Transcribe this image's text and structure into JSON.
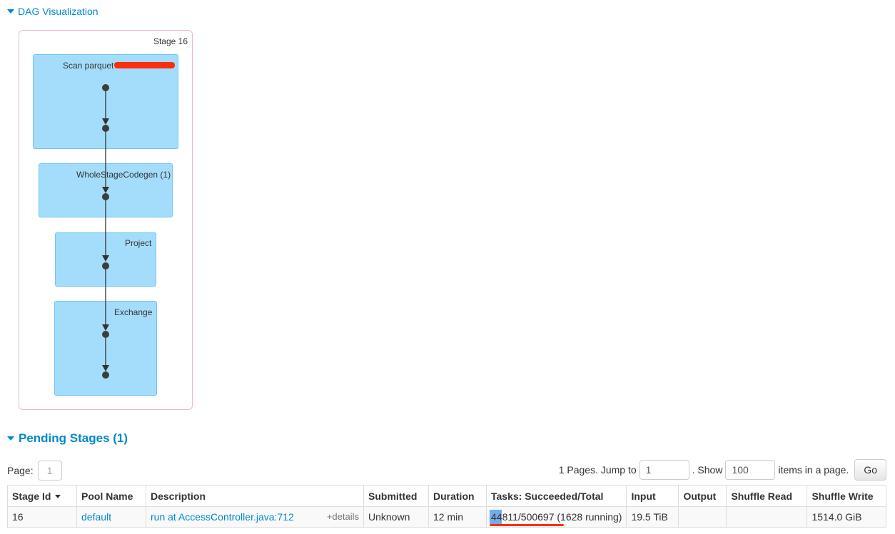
{
  "dag": {
    "toggle_label": "DAG Visualization",
    "stage_label": "Stage 16",
    "nodes": [
      {
        "label": "Scan parquet"
      },
      {
        "label": "WholeStageCodegen (1)"
      },
      {
        "label": "Project"
      },
      {
        "label": "Exchange"
      }
    ]
  },
  "pending": {
    "title": "Pending Stages (1)",
    "page_label": "Page:",
    "page_value": "1",
    "pages_text": "1 Pages. Jump to",
    "jump_value": "1",
    "show_text": ". Show",
    "show_value": "100",
    "items_text": "items in a page.",
    "go_label": "Go"
  },
  "table": {
    "headers": [
      "Stage Id",
      "Pool Name",
      "Description",
      "Submitted",
      "Duration",
      "Tasks: Succeeded/Total",
      "Input",
      "Output",
      "Shuffle Read",
      "Shuffle Write"
    ],
    "row": {
      "stage_id": "16",
      "pool_name": "default",
      "description": "run at AccessController.java:712",
      "details": "+details",
      "submitted": "Unknown",
      "duration": "12 min",
      "tasks": "44811/500697 (1628 running)",
      "tasks_progress": 0.09,
      "input": "19.5 TiB",
      "output": "",
      "shuffle_read": "",
      "shuffle_write": "1514.0 GiB"
    }
  },
  "colors": {
    "link": "#0088cc",
    "node_fill": "#a4ddfb",
    "stage_border": "#f4b6c2",
    "redaction": "#ff2d10"
  }
}
